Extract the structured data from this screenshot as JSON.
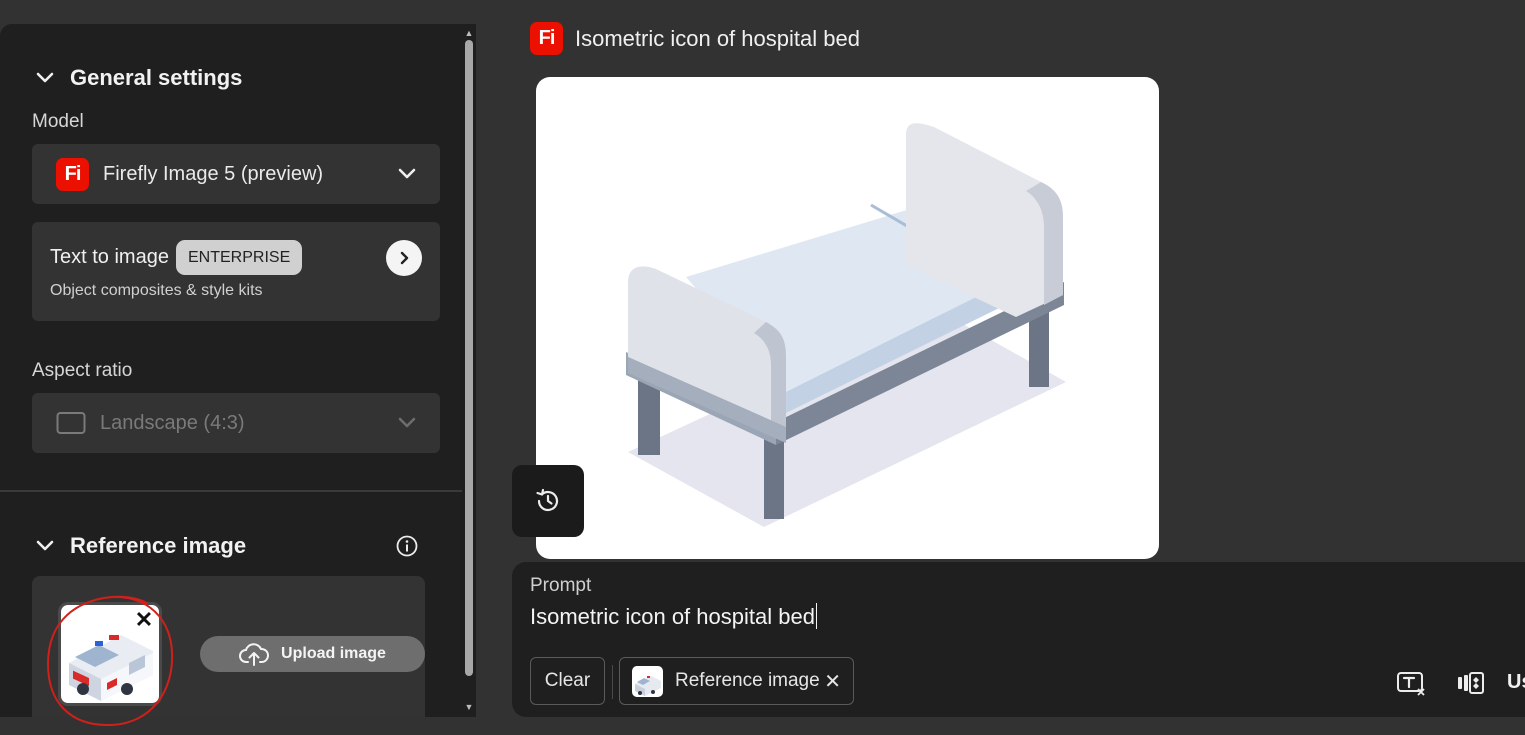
{
  "general_settings": {
    "title": "General settings",
    "model_label": "Model",
    "model_value": "Firefly Image 5 (preview)",
    "logo_text": "Fi",
    "text_to_image": {
      "title": "Text to image",
      "badge": "ENTERPRISE",
      "subtitle": "Object composites & style kits"
    },
    "aspect_ratio_label": "Aspect ratio",
    "aspect_ratio_value": "Landscape (4:3)"
  },
  "reference_image": {
    "title": "Reference image",
    "upload_label": "Upload image",
    "remove_symbol": "✕"
  },
  "generation": {
    "logo_text": "Fi",
    "title": "Isometric icon of hospital bed"
  },
  "prompt": {
    "label": "Prompt",
    "value": "Isometric icon of hospital bed",
    "clear_label": "Clear",
    "chip_label": "Reference image",
    "chip_close": "✕",
    "trailing_text": "Us"
  },
  "colors": {
    "brand_red": "#eb1000",
    "panel": "#1f1f1f",
    "background": "#323232",
    "annotation": "#d0201a"
  }
}
